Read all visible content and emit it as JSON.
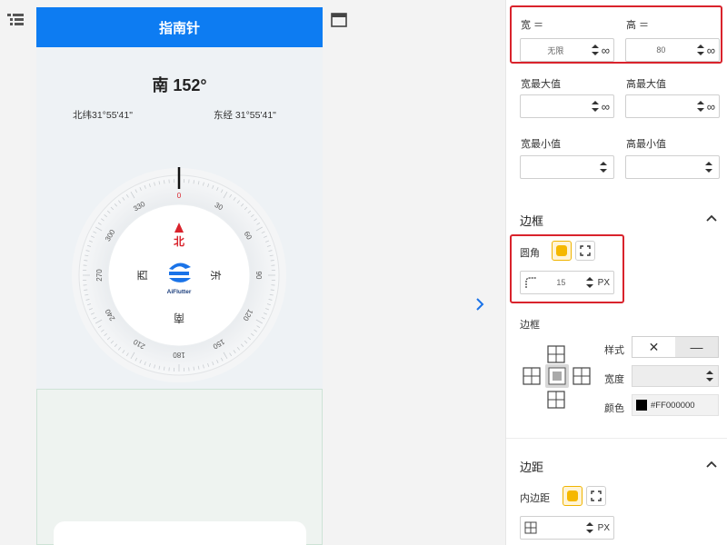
{
  "phone": {
    "title": "指南针",
    "heading": "南 152°",
    "latitude": "北纬31°55'41\"",
    "longitude": "东经 31°55'41\"",
    "compass": {
      "ticks": [
        "0",
        "30",
        "60",
        "90",
        "120",
        "150",
        "180",
        "210",
        "240",
        "270",
        "300",
        "330"
      ],
      "dirs": {
        "north": "北",
        "east": "东",
        "south": "南",
        "west": "西"
      },
      "logo_text": "AiFlutter"
    }
  },
  "panel": {
    "width_label": "宽 ＝",
    "height_label": "高 ＝",
    "width_value": "无限",
    "height_value": "80",
    "infinity": "∞",
    "max_width_label": "宽最大值",
    "max_height_label": "高最大值",
    "min_width_label": "宽最小值",
    "min_height_label": "高最小值",
    "border_section": "边框",
    "radius_label": "圆角",
    "radius_value": "15",
    "radius_unit": "PX",
    "border_label": "边框",
    "style_label": "样式",
    "style_options": [
      "✕",
      "—"
    ],
    "width2_label": "宽度",
    "color_label": "颜色",
    "color_value": "#FF000000",
    "padding_section": "边距",
    "padding_label": "内边距",
    "padding_unit": "PX"
  },
  "colors": {
    "accent": "#0d7cf2",
    "highlight": "#d9232c",
    "toggle": "#f5b800"
  }
}
